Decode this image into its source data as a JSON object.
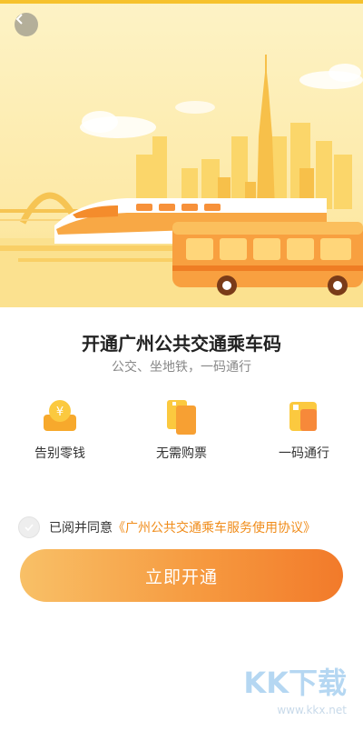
{
  "colors": {
    "accent": "#f69a40",
    "link": "#f08c1a",
    "hero_bg": "#fde9a6"
  },
  "header": {
    "back_icon": "chevron-left-icon"
  },
  "intro": {
    "title": "开通广州公共交通乘车码",
    "subtitle": "公交、坐地铁，一码通行"
  },
  "features": [
    {
      "icon": "coin-icon",
      "label": "告别零钱"
    },
    {
      "icon": "ticket-icon",
      "label": "无需购票"
    },
    {
      "icon": "qr-card-icon",
      "label": "一码通行"
    }
  ],
  "agreement": {
    "prefix": "已阅并同意",
    "link": "《广州公共交通乘车服务使用协议》"
  },
  "cta": {
    "label": "立即开通"
  },
  "watermark": {
    "logo": "KK下载",
    "url": "www.kkx.net"
  }
}
